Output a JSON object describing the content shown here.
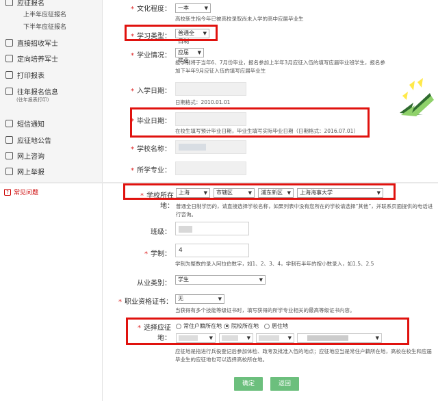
{
  "sidebar": {
    "top_item": "应征报名",
    "sub_items": [
      "上半年应征报名",
      "下半年应征报名"
    ],
    "items": [
      {
        "label": "直接招收军士",
        "icon": "document-icon"
      },
      {
        "label": "定向培养军士",
        "icon": "document-icon"
      },
      {
        "label": "打印报表",
        "icon": "printer-icon"
      },
      {
        "label": "往年报名信息",
        "icon": "document-icon",
        "note": "(往年报表打印)"
      },
      {
        "label": "短信通知",
        "icon": "message-icon"
      },
      {
        "label": "应征地公告",
        "icon": "document-icon"
      },
      {
        "label": "网上咨询",
        "icon": "chat-icon"
      },
      {
        "label": "网上举报",
        "icon": "mail-icon"
      }
    ],
    "help": "常见问题"
  },
  "form_top": {
    "education": {
      "label": "文化程度：",
      "value": "一本",
      "hint": "高校新生指今年已被高校录取尚未入学的高中应届毕业生"
    },
    "study_type": {
      "label": "学习类型：",
      "value": "普通全日制"
    },
    "study_status": {
      "label": "学业情况：",
      "value": "应届毕业",
      "hint": "按学制将于当年6、7月份毕业，报名参加上半年3月应征入伍的填写应届毕业班学生，报名参加下半年9月应征入伍的填写应届毕业生"
    },
    "enroll_date": {
      "label": "入学日期：",
      "hint": "日期格式：2010.01.01"
    },
    "grad_date": {
      "label": "毕业日期：",
      "hint": "在校生填写预计毕业日期，毕业生填写实际毕业日期（日期格式：2016.07.01）"
    },
    "school_name": {
      "label": "学校名称："
    },
    "major": {
      "label": "所学专业："
    }
  },
  "form_bottom": {
    "school_location": {
      "label": "学校所在地：",
      "province": "上海",
      "district": "市辖区",
      "area": "浦东新区",
      "school": "上海海事大学",
      "hint": "普通全日制学历的，请直接选择学校名称，如果列表中没有您所在的学校请选择“其他”，并联系页面提供的电话进行咨询。"
    },
    "class": {
      "label": "班级："
    },
    "duration": {
      "label": "学制：",
      "value": "4",
      "hint": "学制为整数的录入阿拉伯数字，如1、2、3、4，学制有半年的按小数录入，如1.5、2.5"
    },
    "job_category": {
      "label": "从业类别：",
      "value": "学生"
    },
    "certificate": {
      "label": "职业资格证书：",
      "value": "无",
      "hint": "当获得有多个技能等级证书时，填写获得的所学专业相关的最高等级证书内容。"
    },
    "enlist_place": {
      "label": "选择应征地：",
      "options": [
        "常住户籍所在地",
        "院校所在地",
        "居住地"
      ],
      "selected": 1,
      "hint": "应征地是指进行兵役登记后参加体检、政考及批准入伍的地点；应征地应当是常住户籍所在地，高校在校生和应届毕业生的应征地也可以选择高校所在地。"
    },
    "confirm": "确定",
    "back": "返回"
  },
  "colors": {
    "accent": "#e0120e",
    "button": "#6cbf7d",
    "required": "#d22222"
  }
}
